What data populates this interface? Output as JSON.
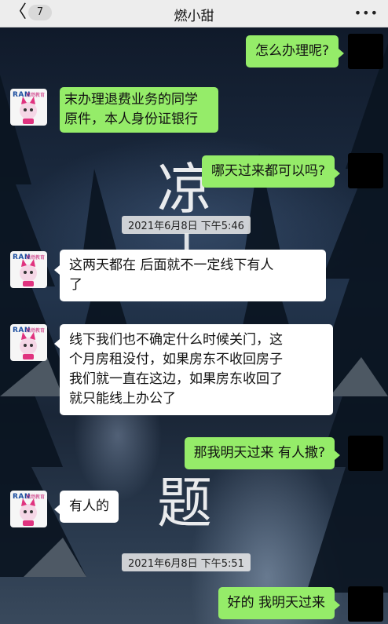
{
  "header": {
    "back_icon": "chevron-left-icon",
    "back_glyph": "〈",
    "unread_count": "7",
    "title": "燃小甜",
    "more_icon": "more-dots-icon",
    "more_glyph": "•••"
  },
  "contact": {
    "logo_text": "RAN",
    "logo_sub": "燃燃教育"
  },
  "messages": [
    {
      "side": "out",
      "text": "怎么办理呢?"
    },
    {
      "side": "in",
      "line1": "末办理退费业务的同学",
      "line2": "原件，本人身份证银行"
    },
    {
      "side": "out",
      "text": "哪天过来都可以吗?"
    },
    {
      "side": "timestamp",
      "text": "2021年6月8日 下午5:46"
    },
    {
      "side": "in",
      "line1": "这两天都在  后面就不一定线下有人",
      "line2": "了"
    },
    {
      "side": "in",
      "line1": "线下我们也不确定什么时候关门，这",
      "line2": "个月房租没付，如果房东不收回房子",
      "line3": "我们就一直在这边，如果房东收回了",
      "line4": "就只能线上办公了"
    },
    {
      "side": "out",
      "text": "那我明天过来  有人撒?"
    },
    {
      "side": "in",
      "text": "有人的"
    },
    {
      "side": "timestamp",
      "text": "2021年6月8日 下午5:51"
    },
    {
      "side": "out",
      "text": "好的  我明天过来"
    }
  ],
  "wallpaper": {
    "big_chars": [
      "凉",
      "上",
      "题"
    ]
  }
}
